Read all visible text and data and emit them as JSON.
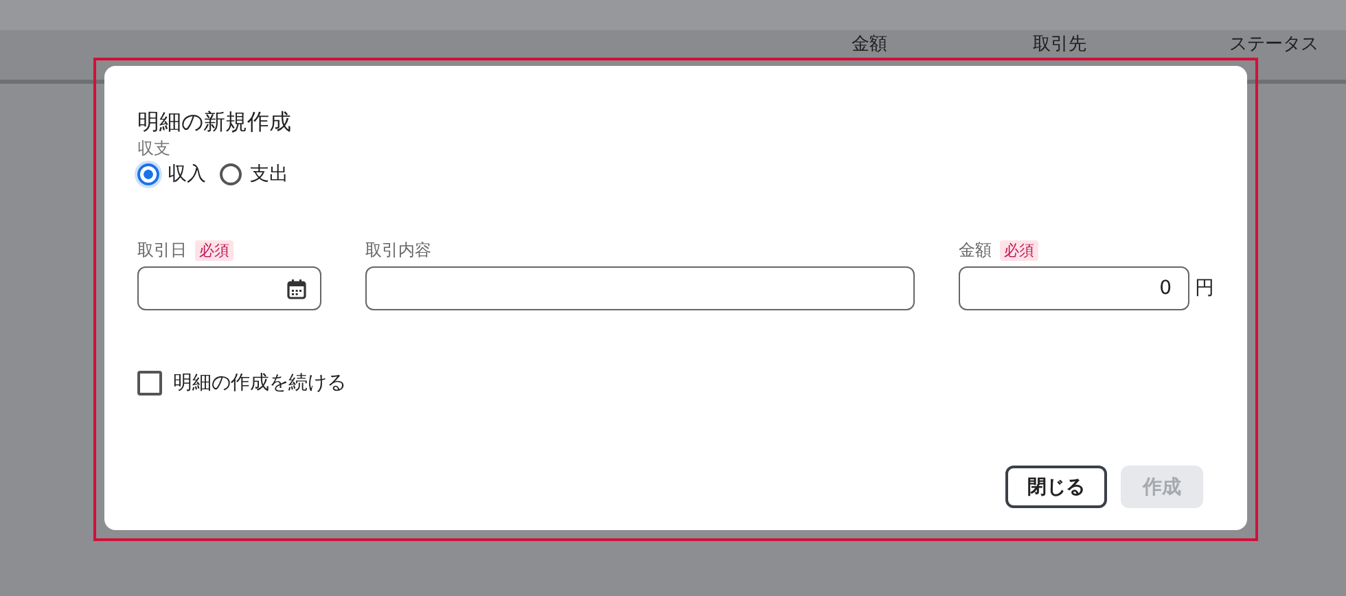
{
  "table": {
    "columns": [
      "金額",
      "取引先",
      "ステータス"
    ]
  },
  "dialog": {
    "title": "明細の新規作成",
    "type_label": "収支",
    "type_options": [
      {
        "label": "収入",
        "selected": true
      },
      {
        "label": "支出",
        "selected": false
      }
    ],
    "fields": [
      {
        "label": "取引日",
        "required": "必須",
        "kind": "date"
      },
      {
        "label": "取引内容",
        "kind": "text"
      },
      {
        "label": "金額",
        "required": "必須",
        "kind": "amount",
        "value": "0",
        "unit": "円"
      }
    ],
    "continue": {
      "label": "明細の作成を続ける",
      "checked": false
    },
    "buttons": [
      {
        "label": "閉じる",
        "disabled": false
      },
      {
        "label": "作成",
        "disabled": true
      }
    ]
  }
}
